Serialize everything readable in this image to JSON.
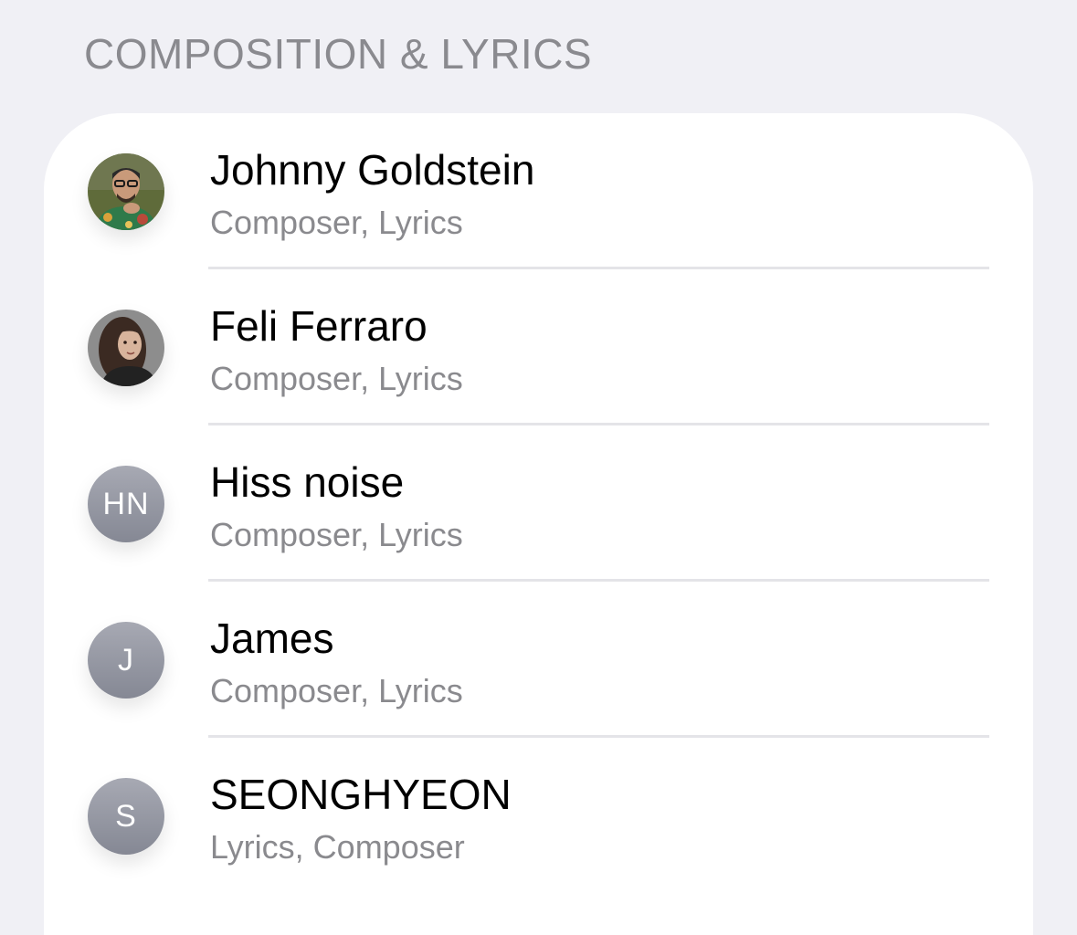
{
  "section": {
    "title": "COMPOSITION & LYRICS"
  },
  "credits": [
    {
      "name": "Johnny Goldstein",
      "roles": "Composer, Lyrics",
      "avatar": "photo"
    },
    {
      "name": "Feli Ferraro",
      "roles": "Composer, Lyrics",
      "avatar": "photo"
    },
    {
      "name": "Hiss noise",
      "roles": "Composer, Lyrics",
      "avatar": "initials",
      "initials": "HN"
    },
    {
      "name": "James",
      "roles": "Composer, Lyrics",
      "avatar": "initials",
      "initials": "J"
    },
    {
      "name": "SEONGHYEON",
      "roles": "Lyrics, Composer",
      "avatar": "initials",
      "initials": "S"
    }
  ],
  "colors": {
    "background": "#f0f0f5",
    "card": "#ffffff",
    "secondary_text": "#8a8a8e",
    "initials_avatar": "#9a9ca6"
  }
}
